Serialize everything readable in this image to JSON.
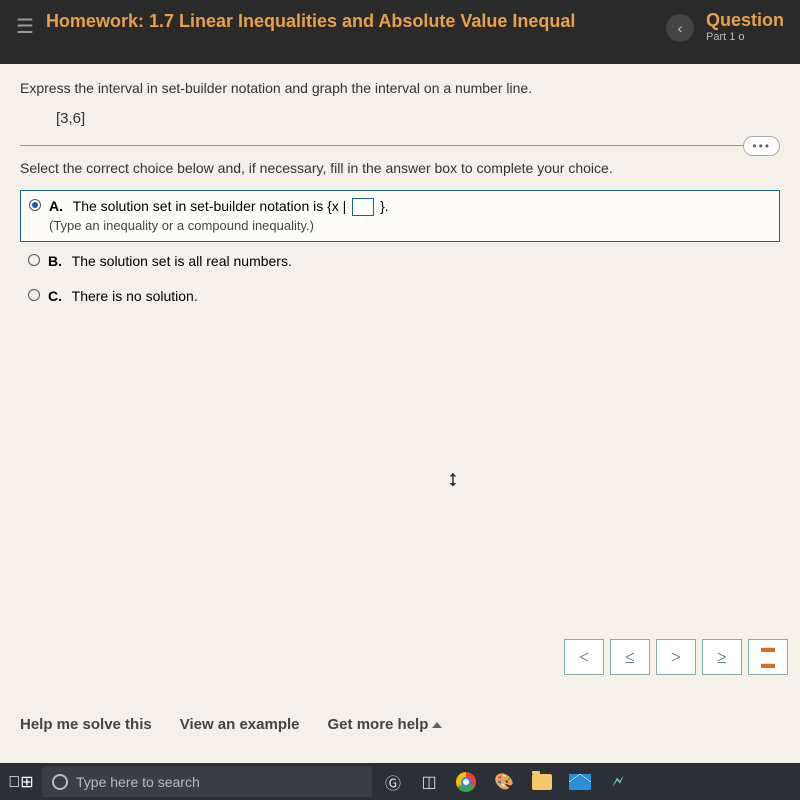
{
  "header": {
    "prefix": "Homework:",
    "title": "1.7 Linear Inequalities and Absolute Value Inequal",
    "question_label": "Question",
    "part_label": "Part 1 o"
  },
  "problem": {
    "instruction": "Express the interval in set-builder notation and graph the interval on a number line.",
    "interval": "[3,6]",
    "select_text": "Select the correct choice below and, if necessary, fill in the answer box to complete your choice."
  },
  "options": {
    "a": {
      "letter": "A.",
      "text_pre": "The solution set in set-builder notation is {x | ",
      "text_post": " }.",
      "hint": "(Type an inequality or a compound inequality.)"
    },
    "b": {
      "letter": "B.",
      "text": "The solution set is all real numbers."
    },
    "c": {
      "letter": "C.",
      "text": "There is no solution."
    }
  },
  "tools": {
    "lt": "<",
    "le": "≤",
    "gt": ">",
    "ge": "≥",
    "frac": "▮/▮"
  },
  "help": {
    "solve": "Help me solve this",
    "example": "View an example",
    "more": "Get more help"
  },
  "taskbar": {
    "search_placeholder": "Type here to search"
  }
}
